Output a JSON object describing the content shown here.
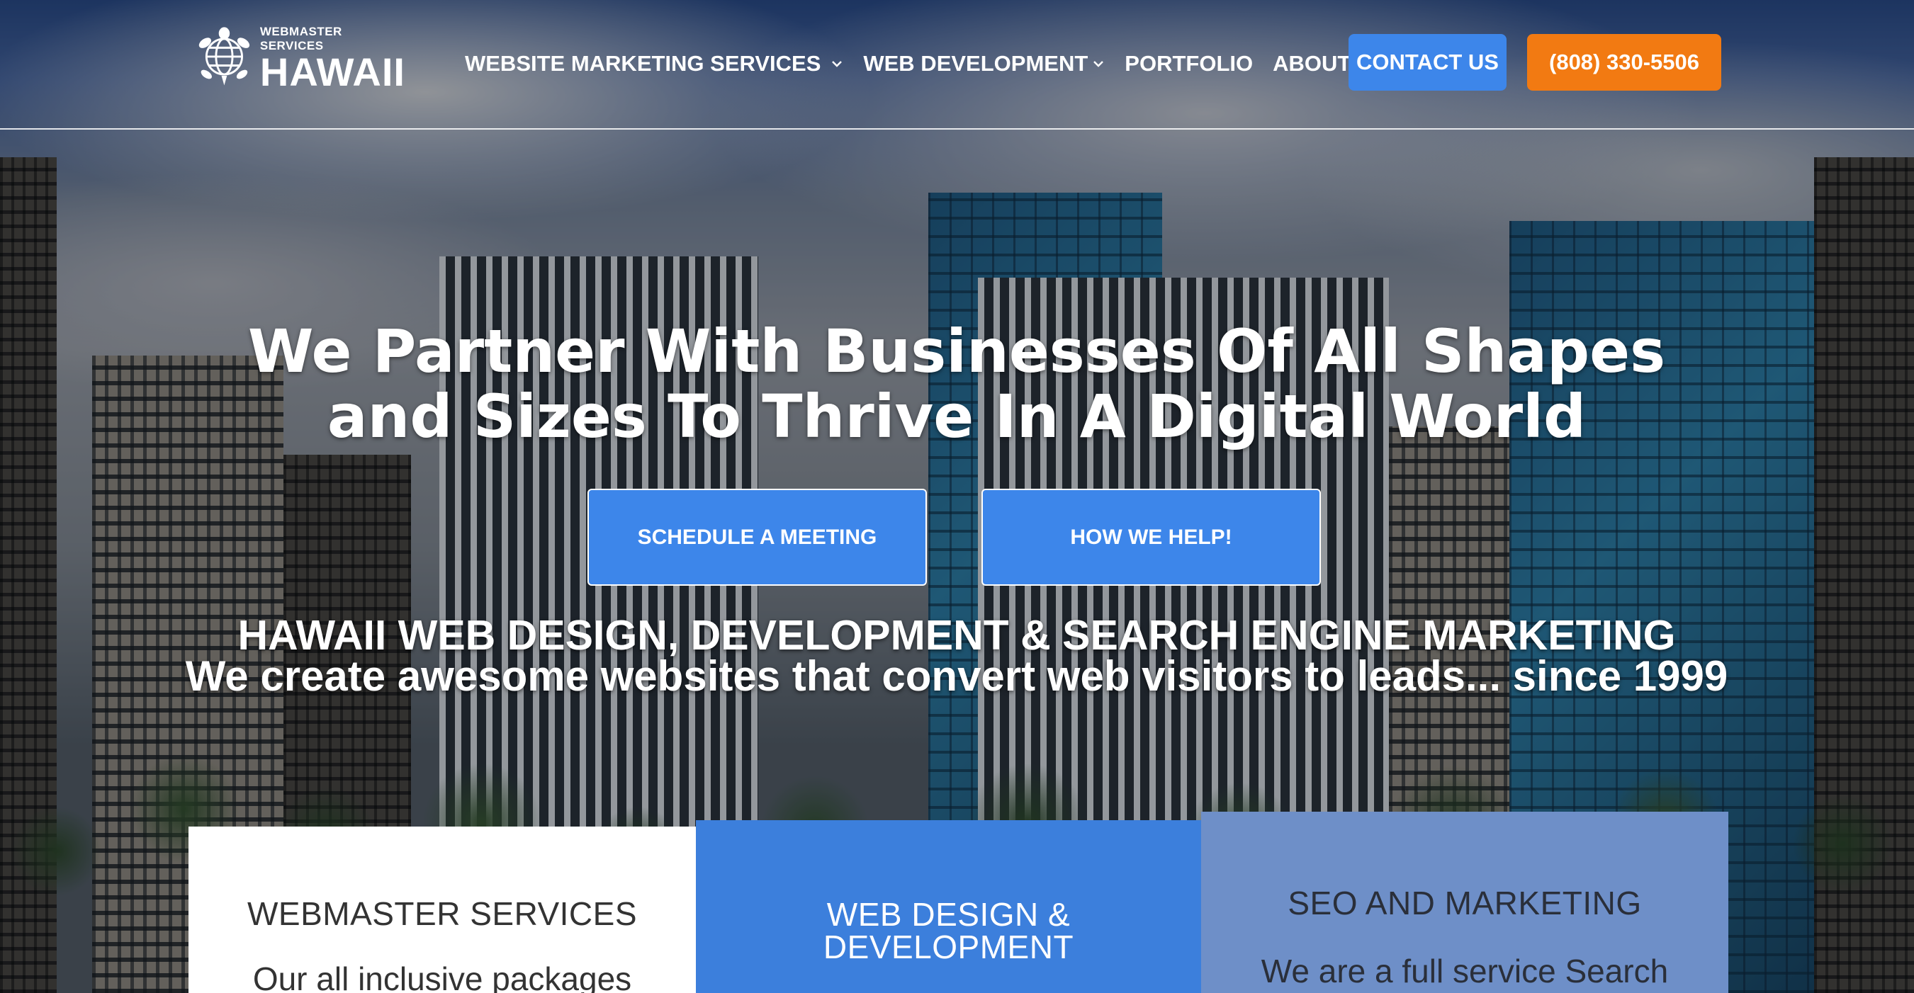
{
  "brand": {
    "logo_small": "WEBMASTER SERVICES",
    "logo_big": "HAWAII",
    "logo_icon": "turtle-globe-icon"
  },
  "nav": {
    "items": [
      {
        "label": "WEBSITE MARKETING SERVICES",
        "has_dropdown": true
      },
      {
        "label": "WEB DEVELOPMENT",
        "has_dropdown": true
      },
      {
        "label": "PORTFOLIO",
        "has_dropdown": false
      },
      {
        "label": "ABOUT US",
        "has_dropdown": true
      }
    ],
    "contact_label": "CONTACT US",
    "phone_label": "(808) 330-5506"
  },
  "hero": {
    "title_line1": "We Partner With Businesses Of All Shapes",
    "title_line2": "and Sizes To Thrive In A Digital World",
    "button_schedule": "SCHEDULE A MEETING",
    "button_help": "HOW WE HELP!",
    "tagline_line1": "HAWAII WEB DESIGN, DEVELOPMENT & SEARCH ENGINE MARKETING",
    "tagline_line2": "We create awesome websites that convert web visitors to leads... since 1999"
  },
  "cards": [
    {
      "title": "WEBMASTER SERVICES",
      "text": "Our all inclusive packages"
    },
    {
      "title_line1": "WEB DESIGN &",
      "title_line2": "DEVELOPMENT"
    },
    {
      "title": "SEO AND MARKETING",
      "text": "We are a full service Search"
    }
  ],
  "colors": {
    "primary_blue": "#3d86ea",
    "phone_orange": "#f27a12",
    "card_blue": "#3c7fdc",
    "card_slate": "#6e8fc8"
  }
}
